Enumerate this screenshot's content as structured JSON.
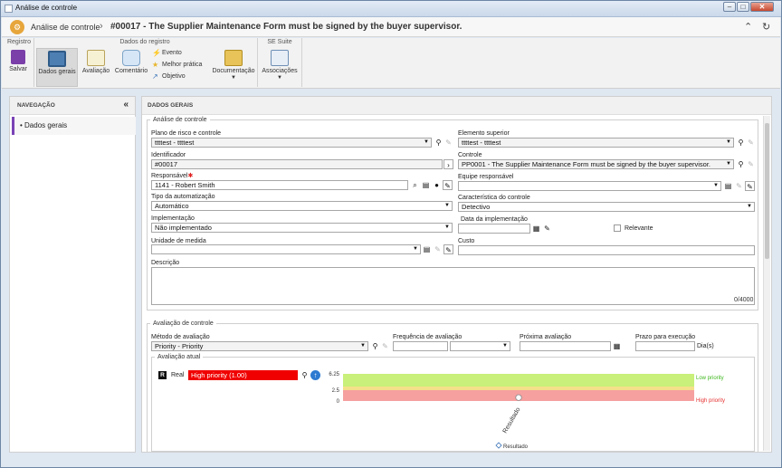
{
  "window": {
    "title": "Análise de controle",
    "min": "–",
    "max": "□",
    "close": "✕"
  },
  "header": {
    "breadcrumb": "Análise de controle",
    "separator": "›",
    "record_title": "#00017 - The Supplier Maintenance Form must be signed by the buyer supervisor.",
    "collapse_icon": "⌃",
    "refresh_icon": "↻"
  },
  "ribbon": {
    "groups": {
      "registro": "Registro",
      "dados_registro": "Dados do registro",
      "se_suite": "SE Suite"
    },
    "buttons": {
      "salvar": "Salvar",
      "dados_gerais": "Dados gerais",
      "avaliacao": "Avaliação",
      "comentario": "Comentário",
      "evento": "Evento",
      "melhor_pratica": "Melhor prática",
      "objetivo": "Objetivo",
      "documentacao": "Documentação",
      "associacoes": "Associações"
    }
  },
  "nav": {
    "title": "NAVEGAÇÃO",
    "collapse": "«",
    "items": [
      {
        "label": "Dados gerais"
      }
    ]
  },
  "main": {
    "title": "DADOS GERAIS",
    "analise": {
      "legend": "Análise de controle",
      "plano_label": "Plano de risco e controle",
      "plano_value": "ttttest - ttttest",
      "elemento_label": "Elemento superior",
      "elemento_value": "ttttest - ttttest",
      "identificador_label": "Identificador",
      "identificador_value": "#00017",
      "controle_label": "Controle",
      "controle_value": "PP0001 - The Supplier Maintenance Form must be signed by the buyer supervisor.",
      "responsavel_label": "Responsável",
      "responsavel_value": "1141 - Robert Smith",
      "equipe_label": "Equipe responsável",
      "equipe_value": "",
      "tipo_label": "Tipo da automatização",
      "tipo_value": "Automático",
      "caracteristica_label": "Característica do controle",
      "caracteristica_value": "Detectivo",
      "implementacao_label": "Implementação",
      "implementacao_value": "Não implementado",
      "data_impl_label": "Data da implementação",
      "data_impl_value": "",
      "relevante_label": "Relevante",
      "unidade_label": "Unidade de medida",
      "unidade_value": "",
      "custo_label": "Custo",
      "custo_value": "",
      "descricao_label": "Descrição",
      "descricao_value": "",
      "descricao_counter": "0/4000"
    },
    "avaliacao": {
      "legend": "Avaliação de controle",
      "metodo_label": "Método de avaliação",
      "metodo_value": "Priority - Priority",
      "frequencia_label": "Frequência de avaliação",
      "frequencia_value": "",
      "proxima_label": "Próxima avaliação",
      "proxima_value": "",
      "prazo_label": "Prazo para execução",
      "prazo_value": "",
      "prazo_unit": "Dia(s)",
      "atual_legend": "Avaliação atual",
      "real_badge": "R",
      "real_label": "Real",
      "real_value": "High priority (1.00)"
    }
  },
  "chart_data": {
    "type": "bar",
    "categories": [
      "Resultado"
    ],
    "series": [
      {
        "name": "Resultado",
        "values": [
          1.0
        ]
      }
    ],
    "bands": [
      {
        "name": "Low priority",
        "from": 2.5,
        "to": 6.25,
        "color": "#c8f07a",
        "label_color": "#3fb71e"
      },
      {
        "name": "",
        "from": 2.5,
        "to": 2.5,
        "color": "#f4e08a",
        "label_color": "#d8b21a"
      },
      {
        "name": "High priority",
        "from": 0,
        "to": 2.5,
        "color": "#f6a0a0",
        "label_color": "#e63030"
      }
    ],
    "y_ticks": [
      "6.25",
      "2.5",
      "0"
    ],
    "ylim": [
      0,
      6.25
    ],
    "xlabel_rotated": "Resultado",
    "legend": "Resultado"
  }
}
